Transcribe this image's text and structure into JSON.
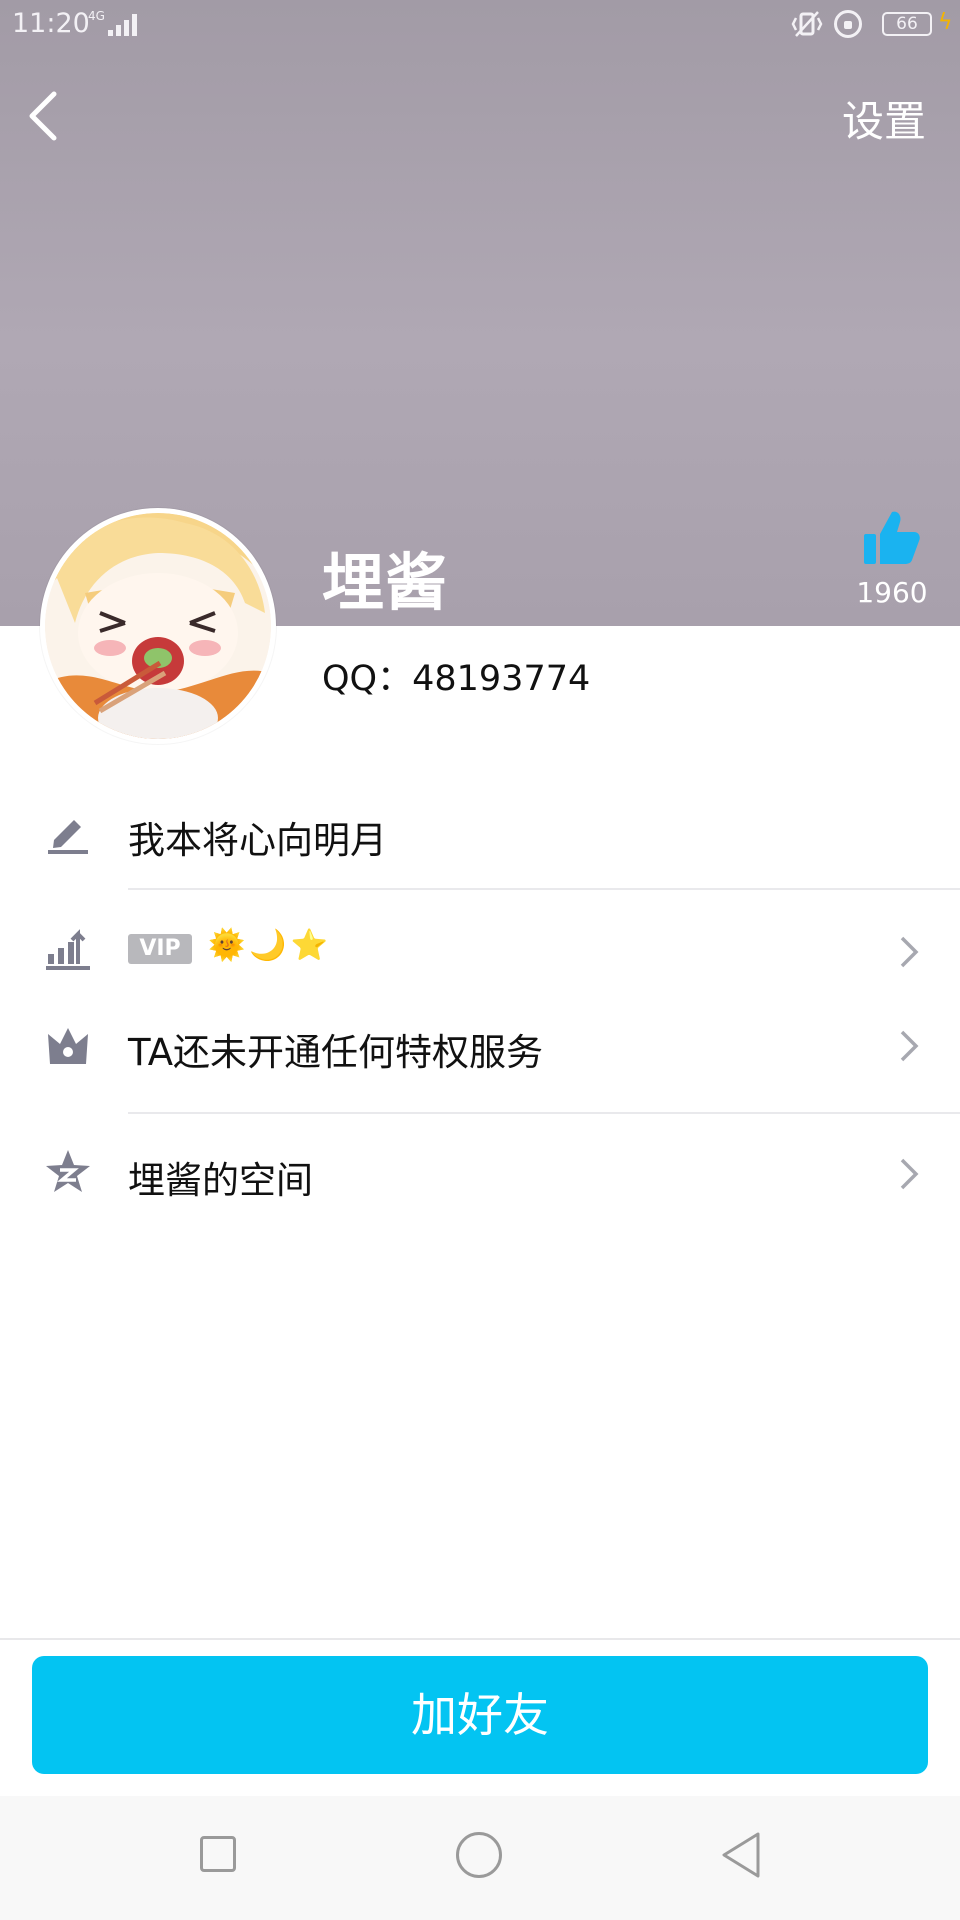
{
  "status_bar": {
    "time": "11:20",
    "network": "4G",
    "battery": "66"
  },
  "header": {
    "settings_label": "设置"
  },
  "profile": {
    "nickname": "埋酱",
    "qq_label": "QQ：48193774",
    "like_count": "1960"
  },
  "rows": {
    "signature": "我本将心向明月",
    "vip_badge": "VIP",
    "level_icons": "🌞🌙⭐",
    "privilege": "TA还未开通任何特权服务",
    "space": "埋酱的空间"
  },
  "actions": {
    "add_friend": "加好友"
  },
  "colors": {
    "accent": "#03c4f2",
    "cover": "#aea6b2",
    "icon_gray": "#7d7e8e"
  }
}
